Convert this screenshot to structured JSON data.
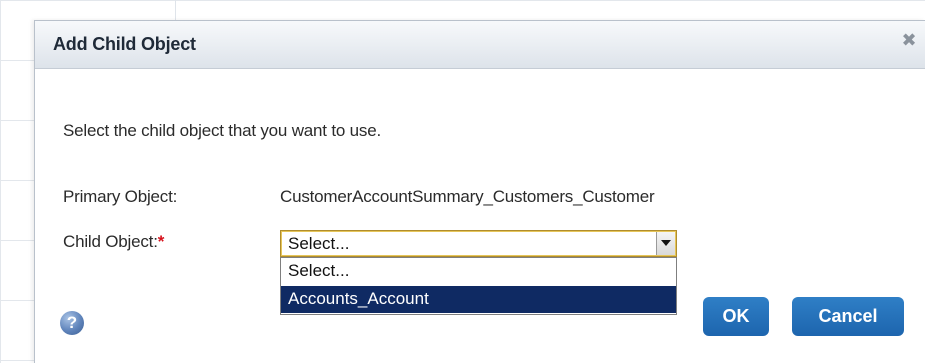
{
  "dialog": {
    "title": "Add Child Object",
    "close_icon": "close-icon",
    "close_glyph": "✖"
  },
  "form": {
    "instruction": "Select the child object that you want to use.",
    "primary_label": "Primary Object:",
    "primary_value": "CustomerAccountSummary_Customers_Customer",
    "child_label": "Child Object:",
    "required_marker": "*",
    "child_select": {
      "selected": "Select...",
      "options": [
        "Select...",
        "Accounts_Account"
      ],
      "highlighted_option": "Accounts_Account"
    }
  },
  "footer": {
    "help_icon": "help-icon",
    "help_glyph": "?",
    "ok_label": "OK",
    "cancel_label": "Cancel"
  },
  "colors": {
    "button_blue": "#1d65ae",
    "highlight_navy": "#0f2a63",
    "required_red": "#d6111b"
  }
}
